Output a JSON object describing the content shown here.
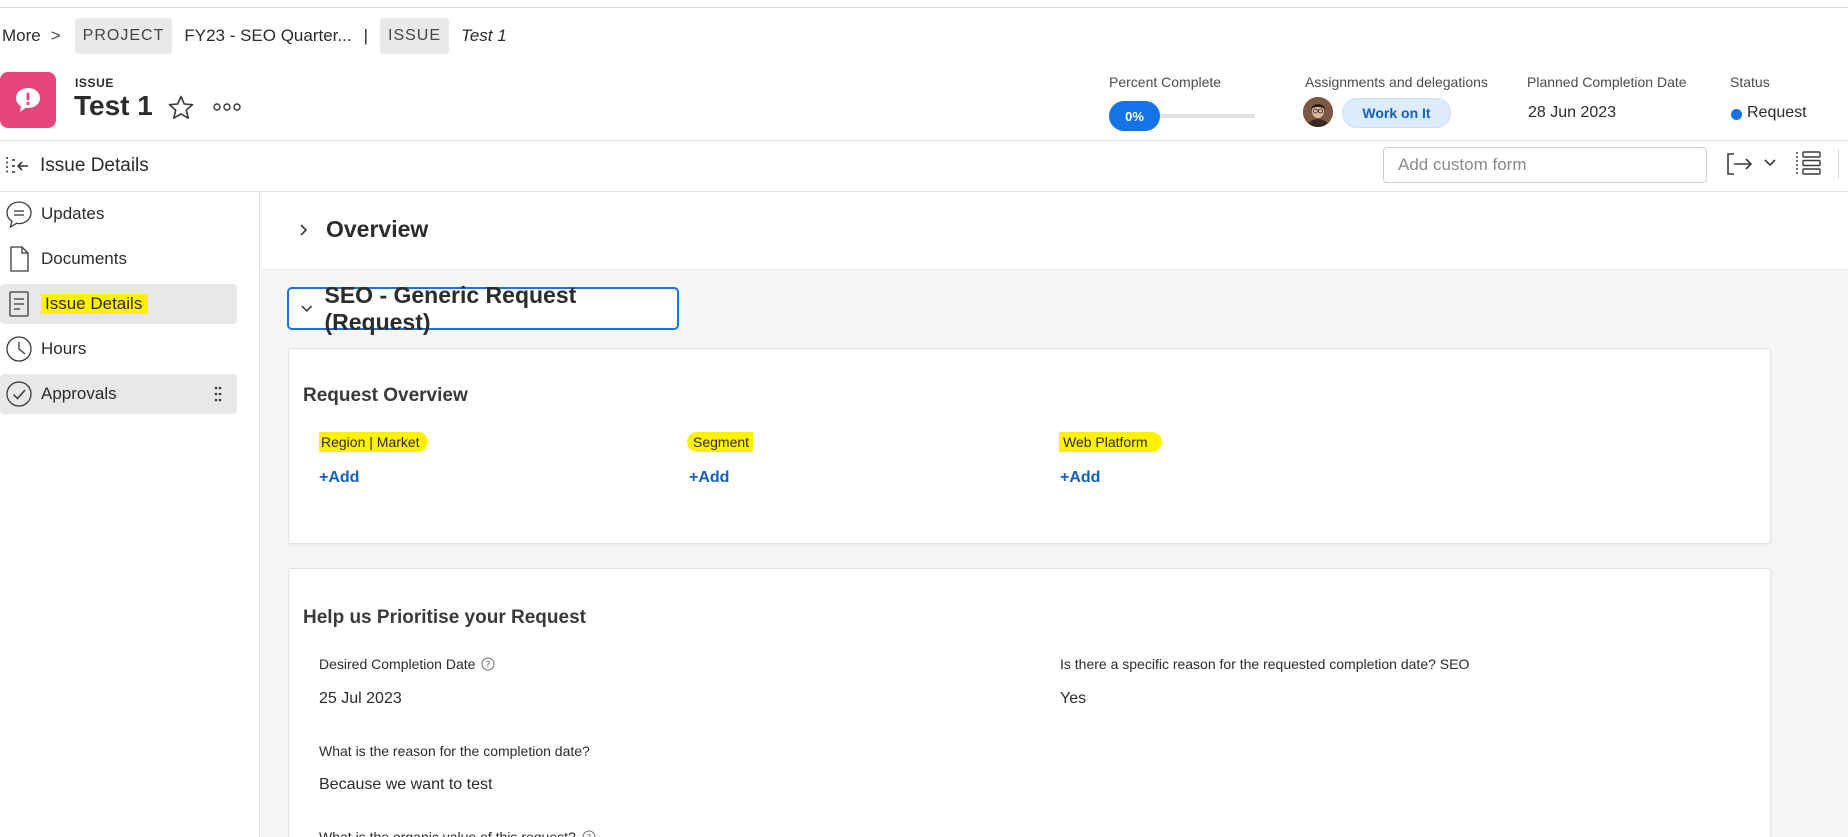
{
  "breadcrumb": {
    "more": "More",
    "sep": ">",
    "project_chip": "PROJECT",
    "project_name": "FY23 - SEO Quarter...",
    "pipe": "|",
    "issue_chip": "ISSUE",
    "issue_name": "Test 1"
  },
  "header": {
    "type_label": "ISSUE",
    "title": "Test 1",
    "percent_label": "Percent Complete",
    "percent_value": "0%",
    "assign_label": "Assignments and delegations",
    "work_button": "Work on It",
    "planned_label": "Planned Completion Date",
    "planned_value": "28 Jun 2023",
    "status_label": "Status",
    "status_value": "Request",
    "colors": {
      "brand": "#e5447c",
      "accent": "#1473e6",
      "highlight": "#fff200"
    }
  },
  "subheader": {
    "title": "Issue Details",
    "custom_form_placeholder": "Add custom form"
  },
  "sidebar": {
    "items": [
      {
        "label": "Updates",
        "icon": "comment-icon"
      },
      {
        "label": "Documents",
        "icon": "document-icon"
      },
      {
        "label": "Issue Details",
        "icon": "details-icon"
      },
      {
        "label": "Hours",
        "icon": "clock-icon"
      },
      {
        "label": "Approvals",
        "icon": "check-circle-icon"
      }
    ]
  },
  "main": {
    "overview_title": "Overview",
    "section_title": "SEO - Generic Request (Request)",
    "request_overview": {
      "title": "Request Overview",
      "fields": [
        {
          "label": "Region | Market",
          "action": "+Add"
        },
        {
          "label": "Segment",
          "action": "+Add"
        },
        {
          "label": "Web Platform",
          "action": "+Add"
        }
      ]
    },
    "prioritise": {
      "title": "Help us Prioritise your Request",
      "desired_label": "Desired Completion Date",
      "desired_value": "25 Jul 2023",
      "reason_specific_label": "Is there a specific reason for the requested completion date? SEO",
      "reason_specific_value": "Yes",
      "reason_label": "What is the reason for the completion date?",
      "reason_value": "Because we want to test",
      "organic_label": "What is the organic value of this request?"
    }
  }
}
